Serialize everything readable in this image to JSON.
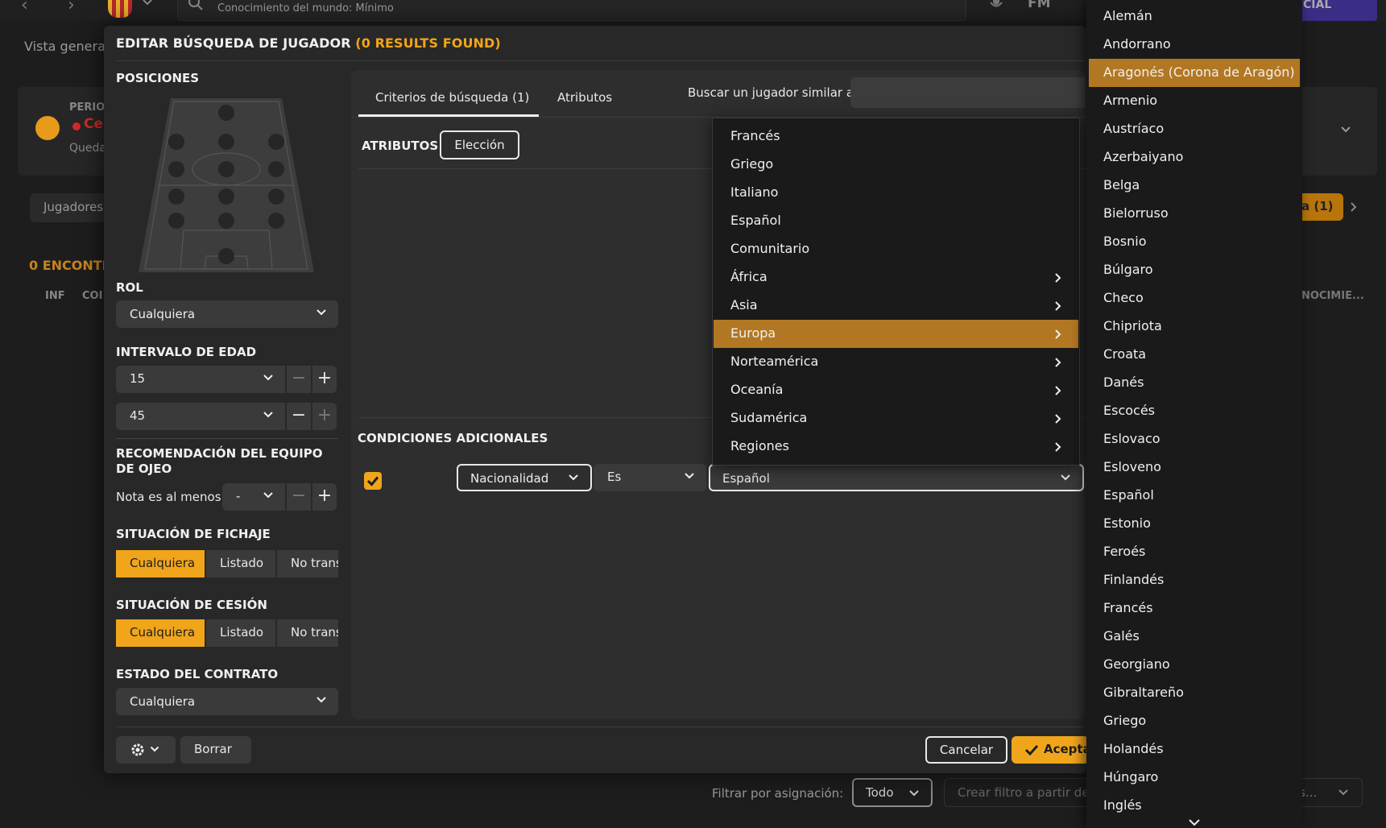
{
  "topbar": {
    "knowledge": "Conocimiento del mundo: Mínimo",
    "fm_label": "FM",
    "continue_label": "CIAL"
  },
  "background": {
    "vista_general": "Vista general",
    "period_label": "PERIO",
    "period_value": "Ce",
    "period_sub": "Queda",
    "right_card_text": "a",
    "jugadores_tab": "Jugadores",
    "right_pill": "a (1)",
    "encontrados": "0 ENCONTR",
    "col_inf": "INF",
    "col_con": "COI",
    "col_conocimiento": "NOCIMIE...",
    "filter_label": "Filtrar por asignación:",
    "filter_value": "Todo",
    "create_filter": "Crear filtro a partir de",
    "right_select": "s..."
  },
  "modal": {
    "title": "EDITAR BÚSQUEDA DE JUGADOR",
    "results": "(0 RESULTS FOUND)",
    "positions_label": "POSICIONES",
    "role_label": "ROL",
    "role_value": "Cualquiera",
    "age_label": "INTERVALO DE EDAD",
    "age_min": "15",
    "age_max": "45",
    "scout_label": "RECOMENDACIÓN DEL EQUIPO DE OJEO",
    "scout_note": "Nota es al menos",
    "scout_value": "-",
    "transfer_label": "SITUACIÓN DE FICHAJE",
    "transfer_options": [
      "Cualquiera",
      "Listado",
      "No trans"
    ],
    "loan_label": "SITUACIÓN DE CESIÓN",
    "loan_options": [
      "Cualquiera",
      "Listado",
      "No trans"
    ],
    "contract_label": "ESTADO DEL CONTRATO",
    "contract_value": "Cualquiera",
    "tabs": [
      "Criterios de búsqueda (1)",
      "Atributos"
    ],
    "similar_label": "Buscar un jugador similar a",
    "attributes_label": "ATRIBUTOS",
    "choice_label": "Elección",
    "conditions_label": "CONDICIONES ADICIONALES",
    "cond_field": "Nacionalidad",
    "cond_op": "Es",
    "cond_value": "Español",
    "borrar": "Borrar",
    "cancel": "Cancelar",
    "accept": "Aceptar"
  },
  "region_menu": {
    "items": [
      "Francés",
      "Griego",
      "Italiano",
      "Español",
      "Comunitario",
      "África",
      "Asia",
      "Europa",
      "Norteamérica",
      "Oceanía",
      "Sudamérica",
      "Regiones"
    ],
    "has_submenu": [
      false,
      false,
      false,
      false,
      false,
      true,
      true,
      true,
      true,
      true,
      true,
      true
    ],
    "highlighted": 7
  },
  "nation_menu": {
    "items": [
      "Alemán",
      "Andorrano",
      "Aragonés (Corona de Aragón)",
      "Armenio",
      "Austríaco",
      "Azerbaiyano",
      "Belga",
      "Bielorruso",
      "Bosnio",
      "Búlgaro",
      "Checo",
      "Chipriota",
      "Croata",
      "Danés",
      "Escocés",
      "Eslovaco",
      "Esloveno",
      "Español",
      "Estonio",
      "Feroés",
      "Finlandés",
      "Francés",
      "Galés",
      "Georgiano",
      "Gibraltareño",
      "Griego",
      "Holandés",
      "Húngaro",
      "Inglés"
    ],
    "highlighted": 2
  },
  "colors": {
    "accent": "#f0a51b",
    "highlight": "#b27722",
    "panel": "#282828",
    "menu": "#1a1a1a"
  }
}
